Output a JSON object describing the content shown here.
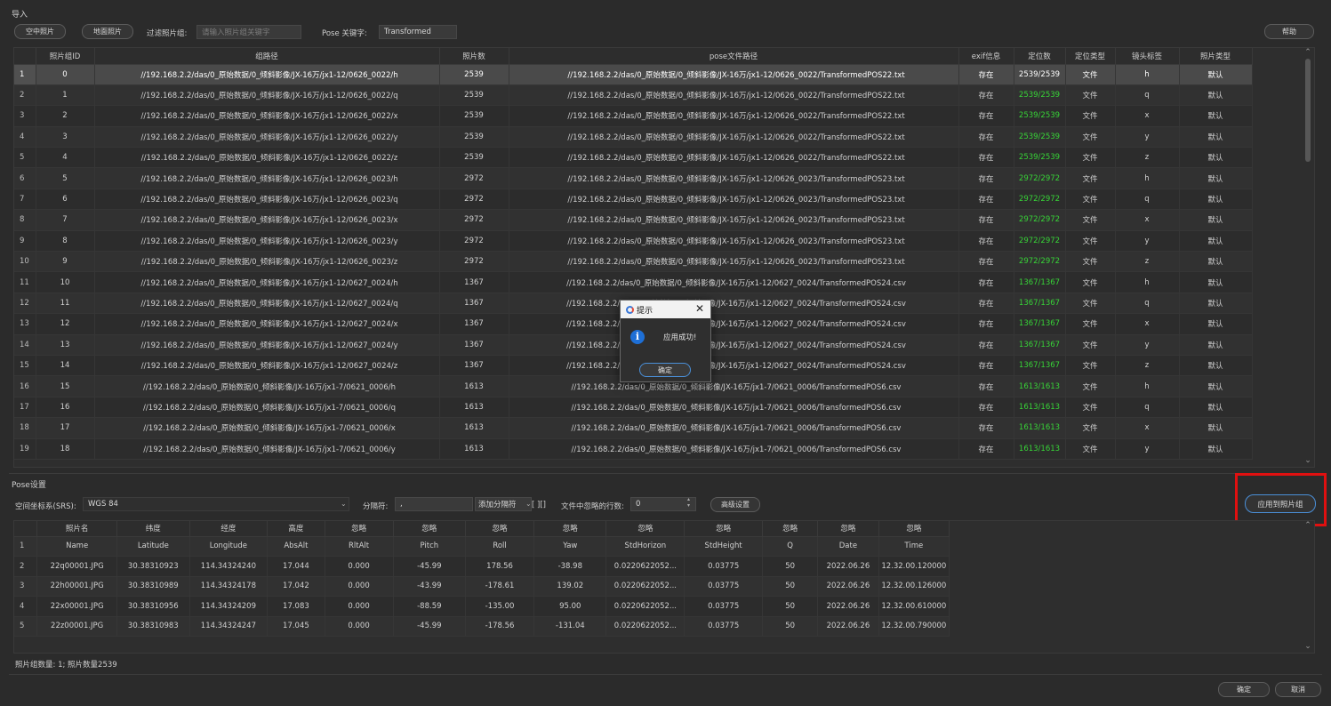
{
  "import_section": {
    "title": "导入",
    "btn_aerial": "空中照片",
    "btn_ground": "地面照片",
    "filter_label": "过滤照片组:",
    "filter_placeholder": "请输入照片组关键字",
    "pose_key_label": "Pose 关键字:",
    "pose_key_value": "Transformed",
    "help_button": "帮助"
  },
  "top_table": {
    "headers": [
      "照片组ID",
      "组路径",
      "照片数",
      "pose文件路径",
      "exif信息",
      "定位数",
      "定位类型",
      "镜头标签",
      "照片类型"
    ],
    "rows": [
      [
        "1",
        "0",
        "//192.168.2.2/das/0_原始数据/0_倾斜影像/JX-16万/jx1-12/0626_0022/h",
        "2539",
        "//192.168.2.2/das/0_原始数据/0_倾斜影像/JX-16万/jx1-12/0626_0022/TransformedPOS22.txt",
        "存在",
        "2539/2539",
        "文件",
        "h",
        "默认"
      ],
      [
        "2",
        "1",
        "//192.168.2.2/das/0_原始数据/0_倾斜影像/JX-16万/jx1-12/0626_0022/q",
        "2539",
        "//192.168.2.2/das/0_原始数据/0_倾斜影像/JX-16万/jx1-12/0626_0022/TransformedPOS22.txt",
        "存在",
        "2539/2539",
        "文件",
        "q",
        "默认"
      ],
      [
        "3",
        "2",
        "//192.168.2.2/das/0_原始数据/0_倾斜影像/JX-16万/jx1-12/0626_0022/x",
        "2539",
        "//192.168.2.2/das/0_原始数据/0_倾斜影像/JX-16万/jx1-12/0626_0022/TransformedPOS22.txt",
        "存在",
        "2539/2539",
        "文件",
        "x",
        "默认"
      ],
      [
        "4",
        "3",
        "//192.168.2.2/das/0_原始数据/0_倾斜影像/JX-16万/jx1-12/0626_0022/y",
        "2539",
        "//192.168.2.2/das/0_原始数据/0_倾斜影像/JX-16万/jx1-12/0626_0022/TransformedPOS22.txt",
        "存在",
        "2539/2539",
        "文件",
        "y",
        "默认"
      ],
      [
        "5",
        "4",
        "//192.168.2.2/das/0_原始数据/0_倾斜影像/JX-16万/jx1-12/0626_0022/z",
        "2539",
        "//192.168.2.2/das/0_原始数据/0_倾斜影像/JX-16万/jx1-12/0626_0022/TransformedPOS22.txt",
        "存在",
        "2539/2539",
        "文件",
        "z",
        "默认"
      ],
      [
        "6",
        "5",
        "//192.168.2.2/das/0_原始数据/0_倾斜影像/JX-16万/jx1-12/0626_0023/h",
        "2972",
        "//192.168.2.2/das/0_原始数据/0_倾斜影像/JX-16万/jx1-12/0626_0023/TransformedPOS23.txt",
        "存在",
        "2972/2972",
        "文件",
        "h",
        "默认"
      ],
      [
        "7",
        "6",
        "//192.168.2.2/das/0_原始数据/0_倾斜影像/JX-16万/jx1-12/0626_0023/q",
        "2972",
        "//192.168.2.2/das/0_原始数据/0_倾斜影像/JX-16万/jx1-12/0626_0023/TransformedPOS23.txt",
        "存在",
        "2972/2972",
        "文件",
        "q",
        "默认"
      ],
      [
        "8",
        "7",
        "//192.168.2.2/das/0_原始数据/0_倾斜影像/JX-16万/jx1-12/0626_0023/x",
        "2972",
        "//192.168.2.2/das/0_原始数据/0_倾斜影像/JX-16万/jx1-12/0626_0023/TransformedPOS23.txt",
        "存在",
        "2972/2972",
        "文件",
        "x",
        "默认"
      ],
      [
        "9",
        "8",
        "//192.168.2.2/das/0_原始数据/0_倾斜影像/JX-16万/jx1-12/0626_0023/y",
        "2972",
        "//192.168.2.2/das/0_原始数据/0_倾斜影像/JX-16万/jx1-12/0626_0023/TransformedPOS23.txt",
        "存在",
        "2972/2972",
        "文件",
        "y",
        "默认"
      ],
      [
        "10",
        "9",
        "//192.168.2.2/das/0_原始数据/0_倾斜影像/JX-16万/jx1-12/0626_0023/z",
        "2972",
        "//192.168.2.2/das/0_原始数据/0_倾斜影像/JX-16万/jx1-12/0626_0023/TransformedPOS23.txt",
        "存在",
        "2972/2972",
        "文件",
        "z",
        "默认"
      ],
      [
        "11",
        "10",
        "//192.168.2.2/das/0_原始数据/0_倾斜影像/JX-16万/jx1-12/0627_0024/h",
        "1367",
        "//192.168.2.2/das/0_原始数据/0_倾斜影像/JX-16万/jx1-12/0627_0024/TransformedPOS24.csv",
        "存在",
        "1367/1367",
        "文件",
        "h",
        "默认"
      ],
      [
        "12",
        "11",
        "//192.168.2.2/das/0_原始数据/0_倾斜影像/JX-16万/jx1-12/0627_0024/q",
        "1367",
        "//192.168.2.2/das/0_原始数据/0_倾斜影像/JX-16万/jx1-12/0627_0024/TransformedPOS24.csv",
        "存在",
        "1367/1367",
        "文件",
        "q",
        "默认"
      ],
      [
        "13",
        "12",
        "//192.168.2.2/das/0_原始数据/0_倾斜影像/JX-16万/jx1-12/0627_0024/x",
        "1367",
        "//192.168.2.2/das/0_原始数据/0_倾斜影像/JX-16万/jx1-12/0627_0024/TransformedPOS24.csv",
        "存在",
        "1367/1367",
        "文件",
        "x",
        "默认"
      ],
      [
        "14",
        "13",
        "//192.168.2.2/das/0_原始数据/0_倾斜影像/JX-16万/jx1-12/0627_0024/y",
        "1367",
        "//192.168.2.2/das/0_原始数据/0_倾斜影像/JX-16万/jx1-12/0627_0024/TransformedPOS24.csv",
        "存在",
        "1367/1367",
        "文件",
        "y",
        "默认"
      ],
      [
        "15",
        "14",
        "//192.168.2.2/das/0_原始数据/0_倾斜影像/JX-16万/jx1-12/0627_0024/z",
        "1367",
        "//192.168.2.2/das/0_原始数据/0_倾斜影像/JX-16万/jx1-12/0627_0024/TransformedPOS24.csv",
        "存在",
        "1367/1367",
        "文件",
        "z",
        "默认"
      ],
      [
        "16",
        "15",
        "//192.168.2.2/das/0_原始数据/0_倾斜影像/JX-16万/jx1-7/0621_0006/h",
        "1613",
        "//192.168.2.2/das/0_原始数据/0_倾斜影像/JX-16万/jx1-7/0621_0006/TransformedPOS6.csv",
        "存在",
        "1613/1613",
        "文件",
        "h",
        "默认"
      ],
      [
        "17",
        "16",
        "//192.168.2.2/das/0_原始数据/0_倾斜影像/JX-16万/jx1-7/0621_0006/q",
        "1613",
        "//192.168.2.2/das/0_原始数据/0_倾斜影像/JX-16万/jx1-7/0621_0006/TransformedPOS6.csv",
        "存在",
        "1613/1613",
        "文件",
        "q",
        "默认"
      ],
      [
        "18",
        "17",
        "//192.168.2.2/das/0_原始数据/0_倾斜影像/JX-16万/jx1-7/0621_0006/x",
        "1613",
        "//192.168.2.2/das/0_原始数据/0_倾斜影像/JX-16万/jx1-7/0621_0006/TransformedPOS6.csv",
        "存在",
        "1613/1613",
        "文件",
        "x",
        "默认"
      ],
      [
        "19",
        "18",
        "//192.168.2.2/das/0_原始数据/0_倾斜影像/JX-16万/jx1-7/0621_0006/y",
        "1613",
        "//192.168.2.2/das/0_原始数据/0_倾斜影像/JX-16万/jx1-7/0621_0006/TransformedPOS6.csv",
        "存在",
        "1613/1613",
        "文件",
        "y",
        "默认"
      ]
    ]
  },
  "dialog": {
    "title": "提示",
    "message": "应用成功!",
    "ok_button": "确定",
    "close_glyph": "✕"
  },
  "pose_section": {
    "title": "Pose设置",
    "srs_label": "空间坐标系(SRS):",
    "srs_value": "WGS 84",
    "separator_label": "分隔符:",
    "separator_value": ",",
    "add_separator_label": "添加分隔符",
    "bracket_text": "[ ][]",
    "skip_rows_label": "文件中忽略的行数:",
    "skip_rows_value": "0",
    "advanced_button": "高级设置",
    "apply_button": "应用到照片组"
  },
  "bottom_table": {
    "headers": [
      "照片名",
      "纬度",
      "经度",
      "高度",
      "忽略",
      "忽略",
      "忽略",
      "忽略",
      "忽略",
      "忽略",
      "忽略",
      "忽略",
      "忽略"
    ],
    "rows": [
      [
        "1",
        "Name",
        "Latitude",
        "Longitude",
        "AbsAlt",
        "RltAlt",
        "Pitch",
        "Roll",
        "Yaw",
        "StdHorizon",
        "StdHeight",
        "Q",
        "Date",
        "Time"
      ],
      [
        "2",
        "22q00001.JPG",
        "30.38310923",
        "114.34324240",
        "17.044",
        "0.000",
        "-45.99",
        "178.56",
        "-38.98",
        "0.0220622052...",
        "0.03775",
        "50",
        "2022.06.26",
        "12.32.00.120000"
      ],
      [
        "3",
        "22h00001.JPG",
        "30.38310989",
        "114.34324178",
        "17.042",
        "0.000",
        "-43.99",
        "-178.61",
        "139.02",
        "0.0220622052...",
        "0.03775",
        "50",
        "2022.06.26",
        "12.32.00.126000"
      ],
      [
        "4",
        "22x00001.JPG",
        "30.38310956",
        "114.34324209",
        "17.083",
        "0.000",
        "-88.59",
        "-135.00",
        "95.00",
        "0.0220622052...",
        "0.03775",
        "50",
        "2022.06.26",
        "12.32.00.610000"
      ],
      [
        "5",
        "22z00001.JPG",
        "30.38310983",
        "114.34324247",
        "17.045",
        "0.000",
        "-45.99",
        "-178.56",
        "-131.04",
        "0.0220622052...",
        "0.03775",
        "50",
        "2022.06.26",
        "12.32.00.790000"
      ]
    ]
  },
  "status": {
    "text": "照片组数量: 1; 照片数量2539"
  },
  "footer": {
    "ok_button": "确定",
    "cancel_button": "取消"
  },
  "colors": {
    "background": "#2b2b2b",
    "green_text": "#37d437",
    "highlight_box": "#e01010",
    "accent_border": "#4a8fd8"
  }
}
